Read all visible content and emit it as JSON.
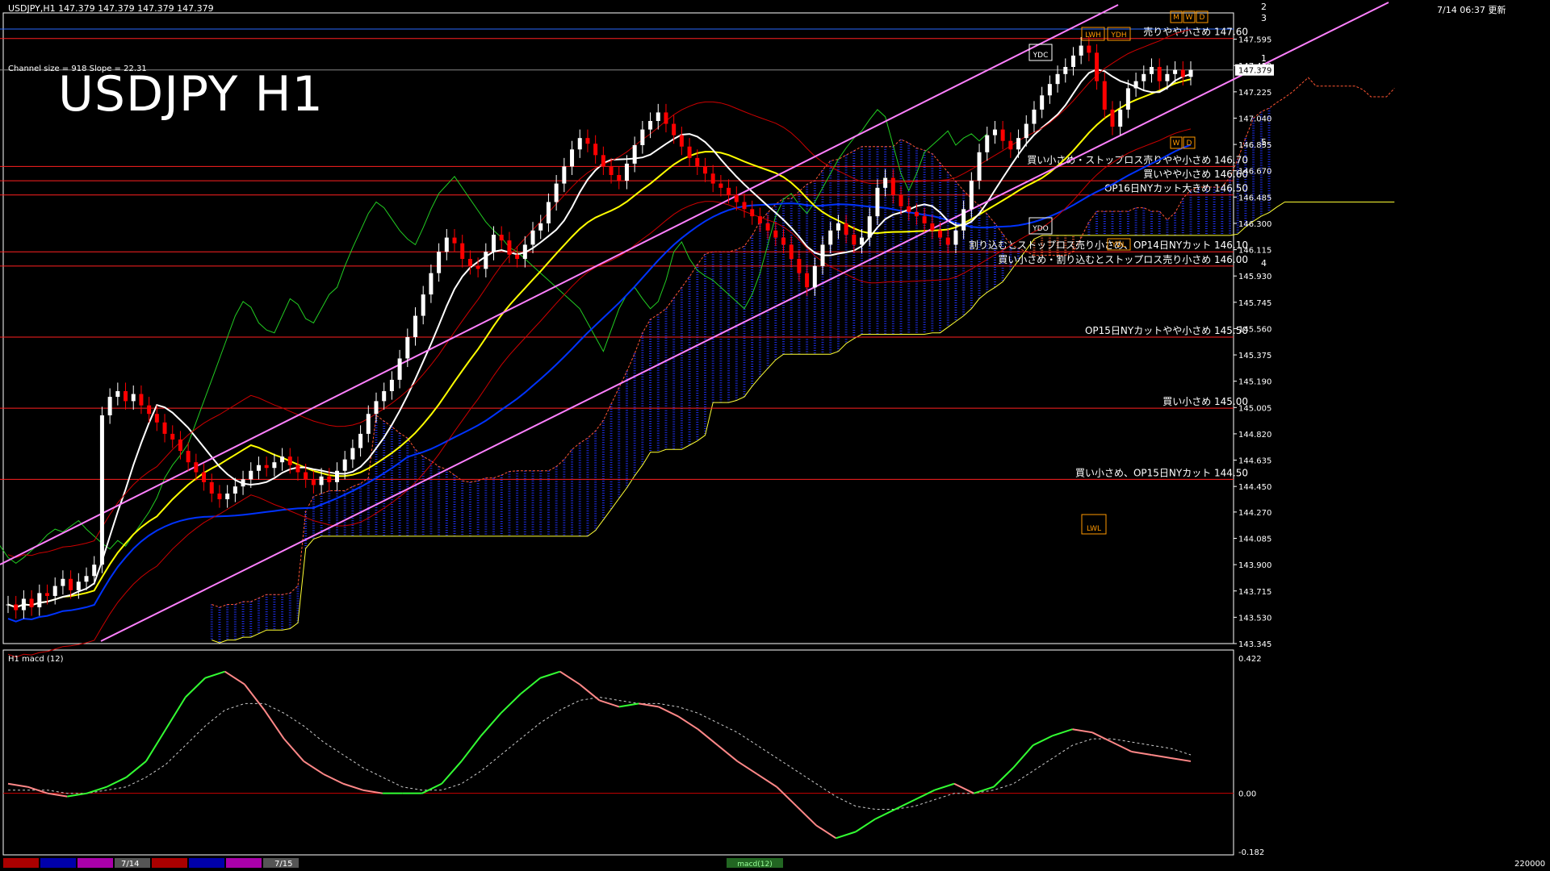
{
  "header": {
    "symbol_line": "USDJPY,H1  147.379 147.379 147.379 147.379",
    "timestamp": "7/14 06:37 更新",
    "channel_info": "Channel size = 918 Slope = 22.31",
    "big_title": "USDJPY H1"
  },
  "colors": {
    "bg": "#000000",
    "grid_frame": "#ffffff",
    "level_line": "#ff2020",
    "up_candle": "#ffffff",
    "down_candle": "#ff0000",
    "channel": "#ff80ff",
    "kumo_bear": "#ff6633",
    "kumo_bull": "#2233ff",
    "tenkan": "#ffffff",
    "ma_yellow": "#ffff00",
    "ma_blue": "#0033ff",
    "chikou": "#22cc22",
    "macd_up": "#33ff33",
    "macd_down": "#ff8888",
    "signal": "#cccccc"
  },
  "chart_data": [
    {
      "type": "candlestick",
      "title": "USDJPY H1",
      "ylim": [
        143.345,
        147.78
      ],
      "y_ticks": [
        "147.595",
        "147.410",
        "147.225",
        "147.040",
        "146.855",
        "146.670",
        "146.485",
        "146.300",
        "146.115",
        "145.930",
        "145.745",
        "145.560",
        "145.375",
        "145.190",
        "145.005",
        "144.820",
        "144.635",
        "144.450",
        "144.270",
        "144.085",
        "143.900",
        "143.715",
        "143.530",
        "143.345"
      ],
      "current_price": "147.379",
      "levels": [
        {
          "price": 147.6,
          "label": "売りやや小さめ 147.60"
        },
        {
          "price": 146.7,
          "label": "買い小さめ・ストップロス売りやや小さめ 146.70"
        },
        {
          "price": 146.6,
          "label": "買いやや小さめ 146.60"
        },
        {
          "price": 146.5,
          "label": "OP16日NYカット大きめ 146.50"
        },
        {
          "price": 146.1,
          "label": "割り込むとストップロス売り小さめ、OP14日NYカット 146.10"
        },
        {
          "price": 146.0,
          "label": "買い小さめ・割り込むとストップロス売り小さめ 146.00"
        },
        {
          "price": 145.5,
          "label": "OP15日NYカットやや小さめ 145.50"
        },
        {
          "price": 145.0,
          "label": "買い小さめ 145.00"
        },
        {
          "price": 144.5,
          "label": "買い小さめ、OP15日NYカット 144.50"
        }
      ],
      "box_labels": [
        "LWH",
        "YDH",
        "M",
        "W",
        "D",
        "YDC",
        "YDO",
        "YDL",
        "W",
        "D",
        "LWL"
      ],
      "wave_labels": [
        "2",
        "3",
        "1",
        "5",
        "4"
      ],
      "close_series": [
        143.62,
        143.58,
        143.66,
        143.6,
        143.7,
        143.68,
        143.75,
        143.8,
        143.72,
        143.78,
        143.82,
        143.9,
        144.95,
        145.08,
        145.12,
        145.05,
        145.1,
        145.02,
        144.96,
        144.9,
        144.82,
        144.78,
        144.7,
        144.62,
        144.55,
        144.48,
        144.4,
        144.36,
        144.4,
        144.45,
        144.5,
        144.56,
        144.6,
        144.58,
        144.62,
        144.66,
        144.6,
        144.55,
        144.5,
        144.46,
        144.52,
        144.48,
        144.56,
        144.64,
        144.72,
        144.82,
        144.96,
        145.05,
        145.12,
        145.2,
        145.35,
        145.5,
        145.65,
        145.8,
        145.95,
        146.1,
        146.2,
        146.16,
        146.05,
        146.0,
        145.98,
        146.1,
        146.22,
        146.18,
        146.08,
        146.05,
        146.15,
        146.25,
        146.3,
        146.45,
        146.58,
        146.7,
        146.82,
        146.9,
        146.86,
        146.78,
        146.7,
        146.64,
        146.6,
        146.72,
        146.85,
        146.96,
        147.02,
        147.08,
        147.0,
        146.92,
        146.84,
        146.76,
        146.7,
        146.65,
        146.58,
        146.55,
        146.5,
        146.45,
        146.4,
        146.35,
        146.3,
        146.25,
        146.2,
        146.15,
        146.05,
        145.95,
        145.85,
        146.0,
        146.15,
        146.25,
        146.3,
        146.22,
        146.15,
        146.2,
        146.35,
        146.55,
        146.62,
        146.5,
        146.42,
        146.38,
        146.35,
        146.3,
        146.25,
        146.2,
        146.15,
        146.25,
        146.4,
        146.6,
        146.8,
        146.92,
        146.96,
        146.88,
        146.82,
        146.9,
        147.0,
        147.1,
        147.2,
        147.28,
        147.35,
        147.4,
        147.48,
        147.55,
        147.5,
        147.3,
        147.1,
        146.98,
        147.1,
        147.25,
        147.3,
        147.35,
        147.4,
        147.3,
        147.35,
        147.38,
        147.33,
        147.38
      ]
    },
    {
      "type": "line",
      "title": "H1  macd (12)",
      "ylim": [
        -0.182,
        0.422
      ],
      "y_ticks": [
        "0.422",
        "0.00",
        "-0.182"
      ],
      "macd": [
        0.03,
        0.02,
        0.0,
        -0.01,
        0.0,
        0.02,
        0.05,
        0.1,
        0.2,
        0.3,
        0.36,
        0.38,
        0.34,
        0.26,
        0.17,
        0.1,
        0.06,
        0.03,
        0.01,
        0.0,
        0.0,
        0.0,
        0.03,
        0.1,
        0.18,
        0.25,
        0.31,
        0.36,
        0.38,
        0.34,
        0.29,
        0.27,
        0.28,
        0.27,
        0.24,
        0.2,
        0.15,
        0.1,
        0.06,
        0.02,
        -0.04,
        -0.1,
        -0.14,
        -0.12,
        -0.08,
        -0.05,
        -0.02,
        0.01,
        0.03,
        0.0,
        0.02,
        0.08,
        0.15,
        0.18,
        0.2,
        0.19,
        0.16,
        0.13,
        0.12,
        0.11,
        0.1
      ],
      "signal": [
        0.01,
        0.01,
        0.01,
        0.0,
        0.0,
        0.01,
        0.02,
        0.05,
        0.09,
        0.15,
        0.21,
        0.26,
        0.28,
        0.28,
        0.25,
        0.21,
        0.16,
        0.12,
        0.08,
        0.05,
        0.02,
        0.01,
        0.01,
        0.03,
        0.07,
        0.12,
        0.17,
        0.22,
        0.26,
        0.29,
        0.3,
        0.29,
        0.28,
        0.28,
        0.27,
        0.25,
        0.22,
        0.19,
        0.15,
        0.11,
        0.07,
        0.03,
        -0.01,
        -0.04,
        -0.05,
        -0.05,
        -0.04,
        -0.02,
        0.0,
        0.0,
        0.01,
        0.03,
        0.07,
        0.11,
        0.15,
        0.17,
        0.17,
        0.16,
        0.15,
        0.14,
        0.12
      ]
    }
  ],
  "footer": {
    "date_labels": [
      "7/14",
      "7/15"
    ],
    "indicator_tab": "macd(12)",
    "right_value": "220000"
  }
}
